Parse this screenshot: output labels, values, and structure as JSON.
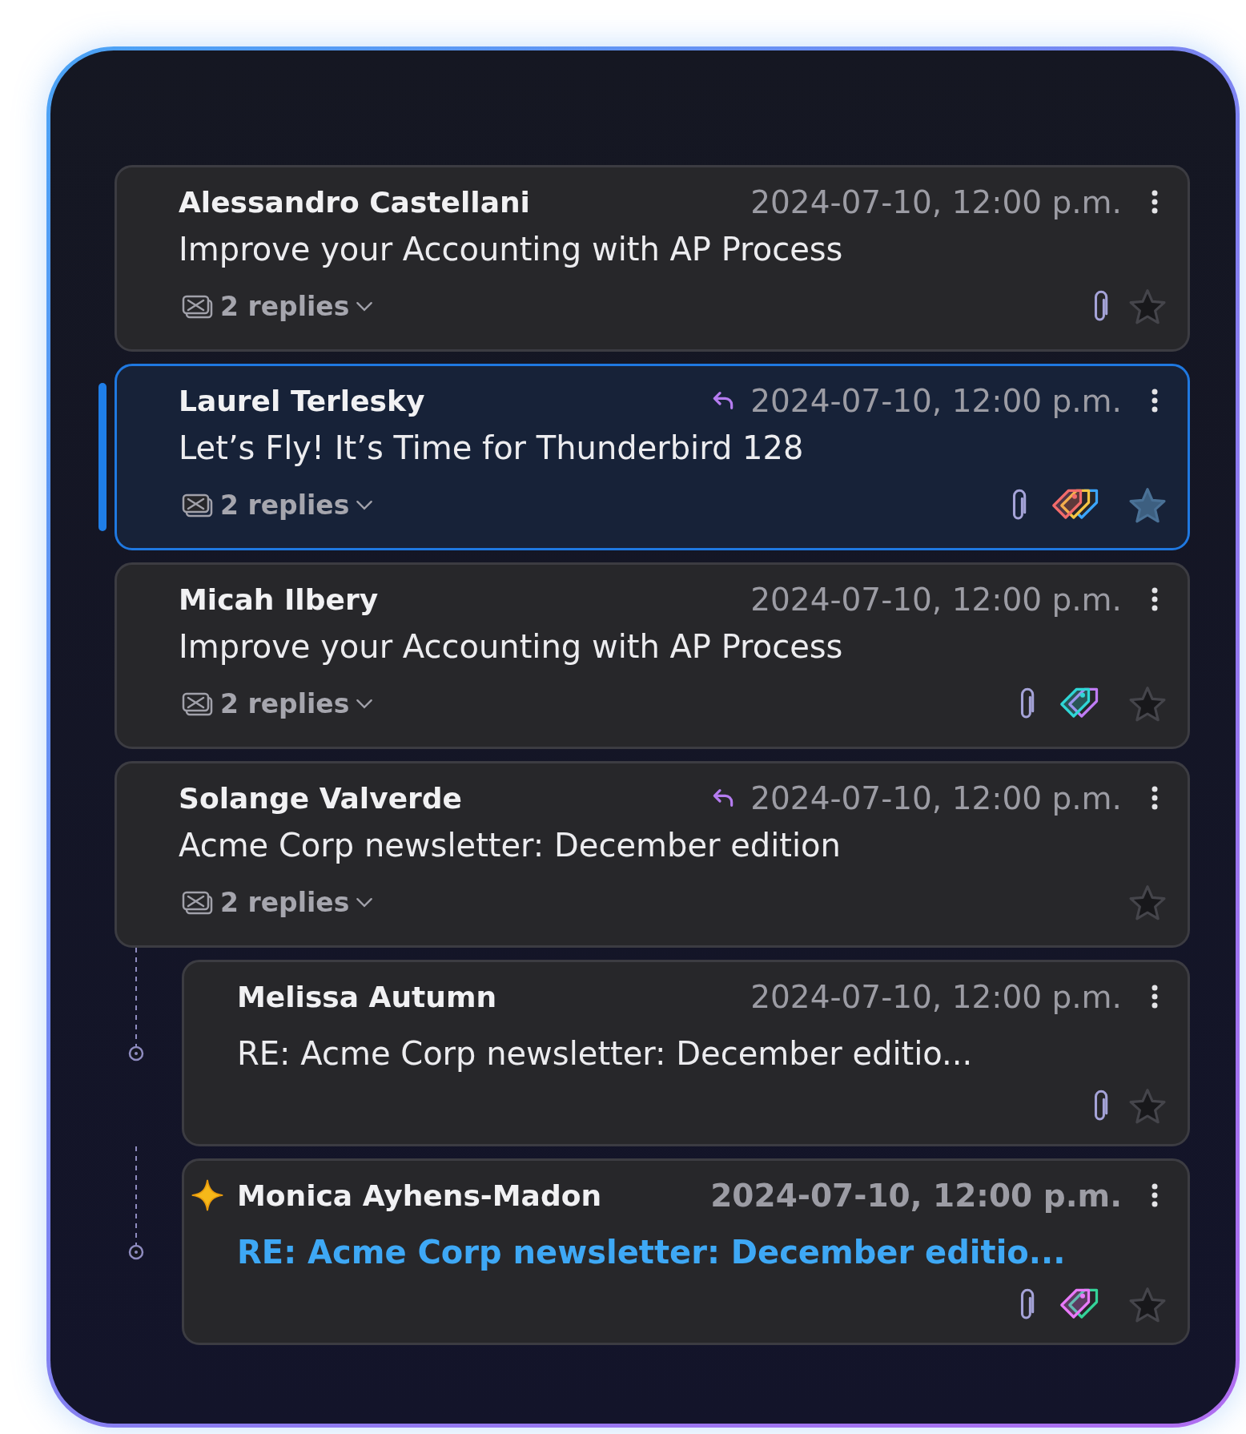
{
  "messages": [
    {
      "sender": "Alessandro Castellani",
      "date": "2024-07-10, 12:00 p.m.",
      "subject": "Improve your Accounting with AP Process",
      "replied": false,
      "selected": false,
      "unread": false,
      "new": false,
      "attachment": true,
      "replies": "2 replies"
    },
    {
      "sender": "Laurel Terlesky",
      "date": "2024-07-10, 12:00 p.m.",
      "subject": "Let’s Fly! It’s Time for Thunderbird 128",
      "replied": true,
      "selected": true,
      "unread": false,
      "new": false,
      "attachment": true,
      "tags": [
        {
          "color": "#f26b6b"
        },
        {
          "color": "#f5c542"
        },
        {
          "color": "#3ba6ff"
        }
      ],
      "replies": "2 replies"
    },
    {
      "sender": "Micah Ilbery",
      "date": "2024-07-10, 12:00 p.m.",
      "subject": "Improve your Accounting with AP Process",
      "replied": false,
      "selected": false,
      "unread": false,
      "new": false,
      "attachment": true,
      "tags": [
        {
          "color": "#2fd6d6"
        },
        {
          "color": "#c07cf5"
        }
      ],
      "replies": "2 replies"
    },
    {
      "sender": "Solange Valverde",
      "date": "2024-07-10, 12:00 p.m.",
      "subject": "Acme Corp newsletter: December edition",
      "replied": true,
      "selected": false,
      "unread": false,
      "new": false,
      "attachment": false,
      "replies": "2 replies",
      "children": [
        {
          "sender": "Melissa Autumn",
          "date": "2024-07-10, 12:00 p.m.",
          "subject": "RE: Acme Corp newsletter: December editio...",
          "replied": false,
          "selected": false,
          "unread": false,
          "new": false,
          "attachment": true
        },
        {
          "sender": "Monica Ayhens-Madon",
          "date": "2024-07-10, 12:00 p.m.",
          "subject": "RE: Acme Corp newsletter: December editio...",
          "replied": false,
          "selected": false,
          "unread": true,
          "new": true,
          "attachment": true,
          "tags": [
            {
              "color": "#e879f9"
            },
            {
              "color": "#34d399"
            }
          ]
        }
      ]
    }
  ]
}
